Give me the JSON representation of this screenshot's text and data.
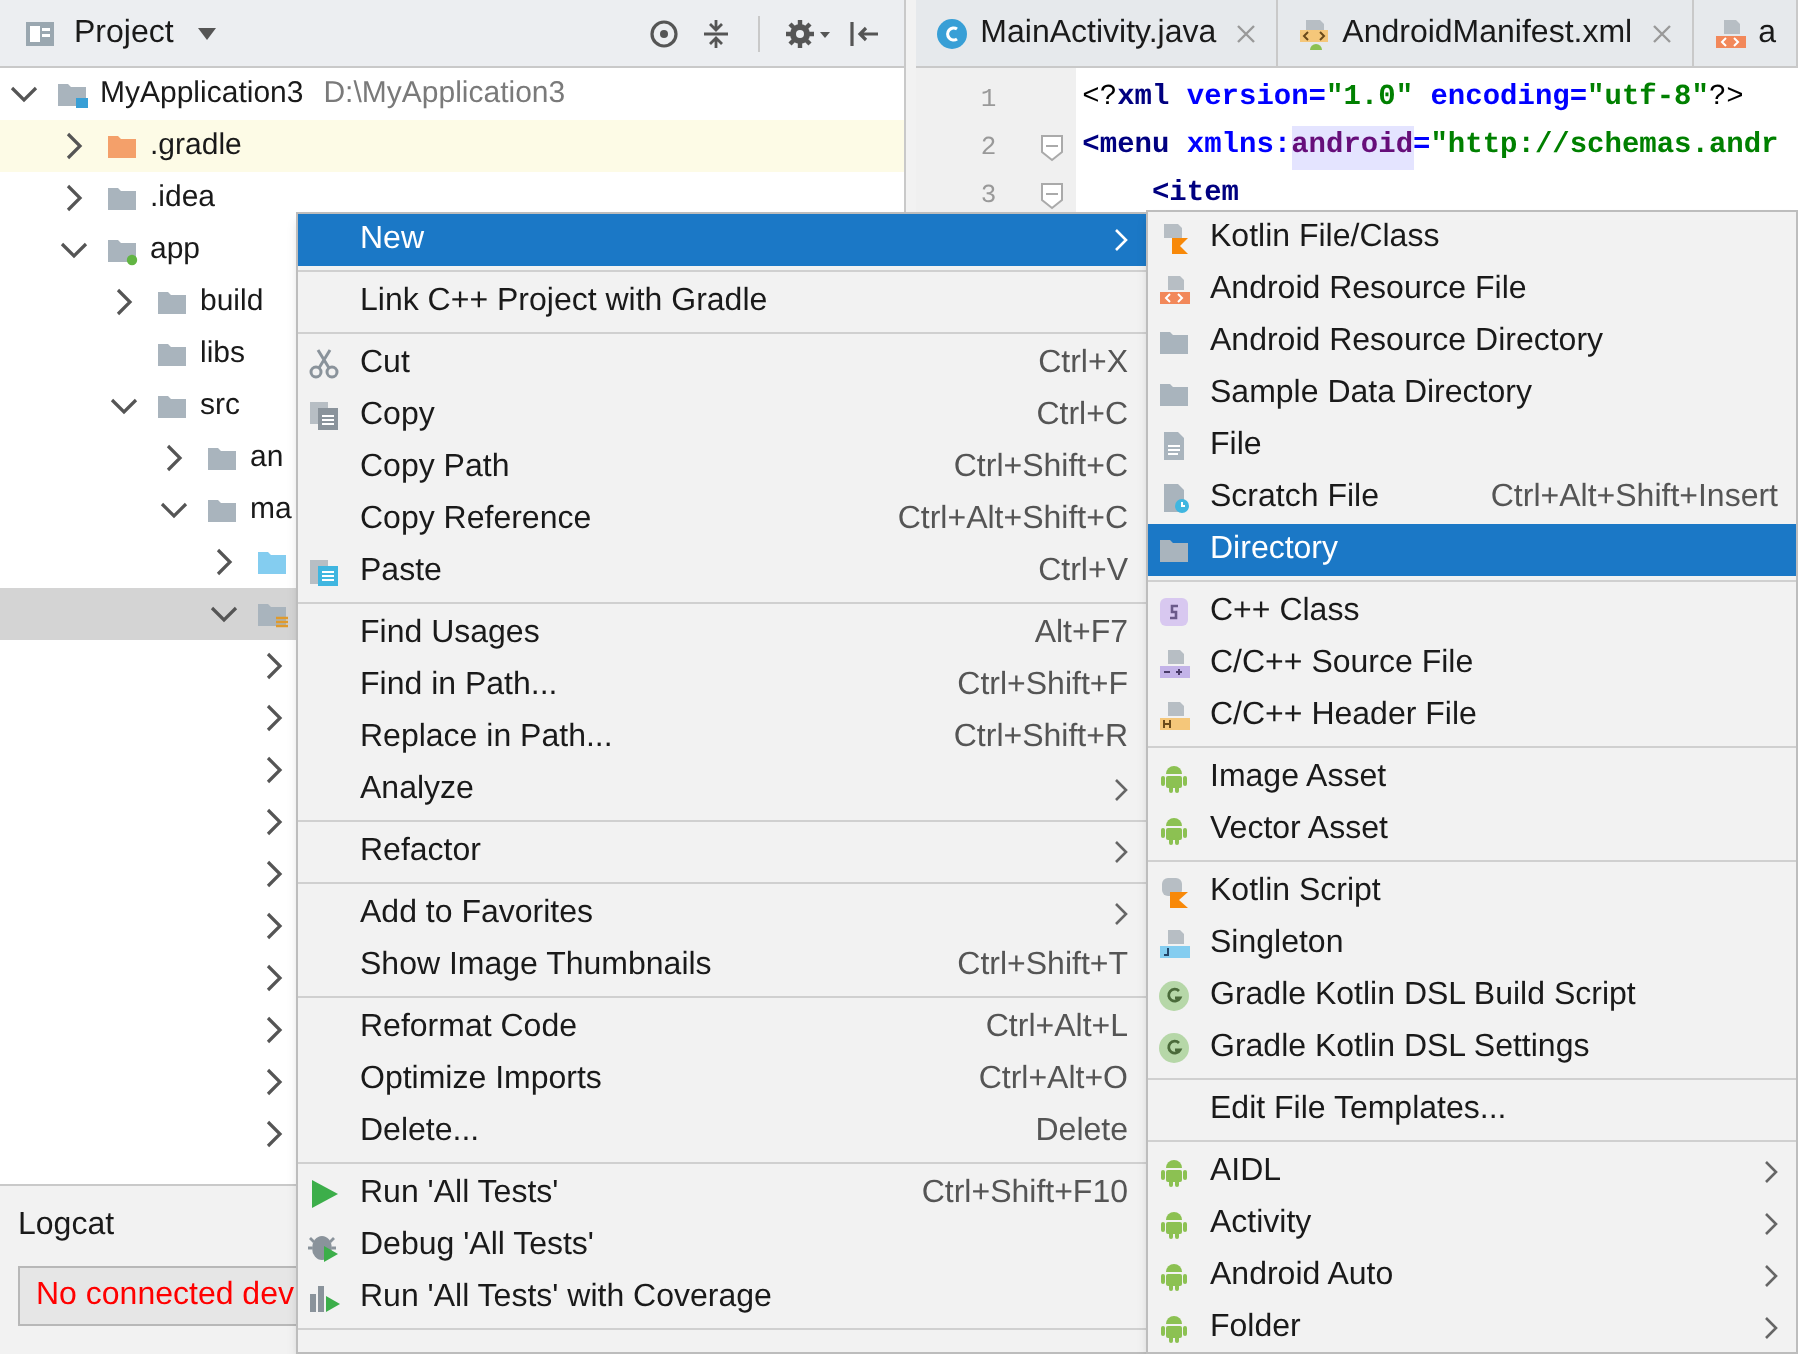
{
  "project_panel": {
    "title": "Project",
    "tree": [
      {
        "label": "MyApplication3",
        "hint": "D:\\MyApplication3",
        "kind": "module",
        "expanded": true,
        "selected": false,
        "children": [
          {
            "label": ".gradle",
            "kind": "excluded",
            "expanded": false,
            "selected": false
          },
          {
            "label": ".idea",
            "kind": "folder",
            "expanded": false,
            "selected": false
          },
          {
            "label": "app",
            "kind": "app",
            "expanded": true,
            "selected": false,
            "children": [
              {
                "label": "build",
                "kind": "folder",
                "expanded": false,
                "selected": false
              },
              {
                "label": "libs",
                "kind": "folder",
                "selected": false
              },
              {
                "label": "src",
                "kind": "folder",
                "expanded": true,
                "selected": false,
                "children": [
                  {
                    "label": "an",
                    "kind": "folder",
                    "expanded": false,
                    "selected": false
                  },
                  {
                    "label": "ma",
                    "kind": "folder",
                    "expanded": true,
                    "selected": false,
                    "children": [
                      {
                        "kind": "source",
                        "expanded": false,
                        "selected": false
                      },
                      {
                        "kind": "resources",
                        "expanded": true,
                        "selected": true,
                        "children": [
                          {
                            "expanded": false,
                            "selected": false
                          },
                          {
                            "expanded": false,
                            "selected": false
                          },
                          {
                            "expanded": false,
                            "selected": false
                          },
                          {
                            "expanded": false,
                            "selected": false
                          },
                          {
                            "expanded": false,
                            "selected": false
                          },
                          {
                            "expanded": false,
                            "selected": false
                          },
                          {
                            "expanded": false,
                            "selected": false
                          },
                          {
                            "expanded": false,
                            "selected": false
                          },
                          {
                            "expanded": false,
                            "selected": false
                          },
                          {
                            "expanded": false,
                            "selected": false
                          }
                        ]
                      }
                    ]
                  }
                ]
              }
            ]
          }
        ]
      }
    ]
  },
  "editor": {
    "tabs": [
      {
        "label": "MainActivity.java",
        "kind": "class",
        "closable": true
      },
      {
        "label": "AndroidManifest.xml",
        "kind": "manifest",
        "closable": true
      },
      {
        "label": "a",
        "kind": "resource",
        "closable": false
      }
    ],
    "lines": [
      {
        "number": "1",
        "fold": false,
        "tokens": [
          {
            "text": "<?",
            "kind": "plain"
          },
          {
            "text": "xml",
            "kind": "tag"
          },
          {
            "text": " version=",
            "kind": "attr"
          },
          {
            "text": "\"1.0\"",
            "kind": "value"
          },
          {
            "text": " encoding=",
            "kind": "attr"
          },
          {
            "text": "\"utf-8\"",
            "kind": "value"
          },
          {
            "text": "?>",
            "kind": "plain"
          }
        ]
      },
      {
        "number": "2",
        "fold": true,
        "tokens": [
          {
            "text": "<menu",
            "kind": "tag"
          },
          {
            "text": " xmlns:",
            "kind": "attr"
          },
          {
            "text": "android",
            "kind": "ns"
          },
          {
            "text": "=",
            "kind": "attr"
          },
          {
            "text": "\"http://schemas.andr",
            "kind": "value"
          }
        ]
      },
      {
        "number": "3",
        "fold": true,
        "tokens": [
          {
            "text": "    <item",
            "kind": "tag"
          }
        ]
      }
    ]
  },
  "logcat": {
    "title": "Logcat",
    "device": "No connected dev"
  },
  "context_menu": {
    "items": [
      {
        "kind": "plain",
        "label": "New",
        "submenu": true,
        "selected": true
      },
      {
        "kind": "separator"
      },
      {
        "kind": "plain",
        "label": "Link C++ Project with Gradle",
        "submenu": false,
        "selected": false
      },
      {
        "kind": "separator"
      },
      {
        "kind": "scissors",
        "label": "Cut",
        "shortcut": "Ctrl+X",
        "submenu": false,
        "selected": false
      },
      {
        "kind": "copy",
        "label": "Copy",
        "shortcut": "Ctrl+C",
        "submenu": false,
        "selected": false
      },
      {
        "kind": "plain",
        "label": "Copy Path",
        "shortcut": "Ctrl+Shift+C",
        "submenu": false,
        "selected": false
      },
      {
        "kind": "plain",
        "label": "Copy Reference",
        "shortcut": "Ctrl+Alt+Shift+C",
        "submenu": false,
        "selected": false
      },
      {
        "kind": "paste",
        "label": "Paste",
        "shortcut": "Ctrl+V",
        "submenu": false,
        "selected": false
      },
      {
        "kind": "separator"
      },
      {
        "kind": "plain",
        "label": "Find Usages",
        "shortcut": "Alt+F7",
        "submenu": false,
        "selected": false
      },
      {
        "kind": "plain",
        "label": "Find in Path...",
        "shortcut": "Ctrl+Shift+F",
        "submenu": false,
        "selected": false
      },
      {
        "kind": "plain",
        "label": "Replace in Path...",
        "shortcut": "Ctrl+Shift+R",
        "submenu": false,
        "selected": false
      },
      {
        "kind": "plain",
        "label": "Analyze",
        "submenu": true,
        "selected": false
      },
      {
        "kind": "separator"
      },
      {
        "kind": "plain",
        "label": "Refactor",
        "submenu": true,
        "selected": false
      },
      {
        "kind": "separator"
      },
      {
        "kind": "plain",
        "label": "Add to Favorites",
        "submenu": true,
        "selected": false
      },
      {
        "kind": "plain",
        "label": "Show Image Thumbnails",
        "shortcut": "Ctrl+Shift+T",
        "submenu": false,
        "selected": false
      },
      {
        "kind": "separator"
      },
      {
        "kind": "plain",
        "label": "Reformat Code",
        "shortcut": "Ctrl+Alt+L",
        "submenu": false,
        "selected": false
      },
      {
        "kind": "plain",
        "label": "Optimize Imports",
        "shortcut": "Ctrl+Alt+O",
        "submenu": false,
        "selected": false
      },
      {
        "kind": "plain",
        "label": "Delete...",
        "shortcut": "Delete",
        "submenu": false,
        "selected": false
      },
      {
        "kind": "separator"
      },
      {
        "kind": "run",
        "label": "Run 'All Tests'",
        "shortcut": "Ctrl+Shift+F10",
        "submenu": false,
        "selected": false
      },
      {
        "kind": "debug",
        "label": "Debug 'All Tests'",
        "submenu": false,
        "selected": false
      },
      {
        "kind": "coverage",
        "label": "Run 'All Tests' with Coverage",
        "submenu": false,
        "selected": false
      },
      {
        "kind": "separator"
      }
    ]
  },
  "submenu": {
    "items": [
      {
        "kind": "kotlin",
        "label": "Kotlin File/Class",
        "submenu": false,
        "selected": false
      },
      {
        "kind": "resource",
        "label": "Android Resource File",
        "submenu": false,
        "selected": false
      },
      {
        "kind": "folder",
        "label": "Android Resource Directory",
        "submenu": false,
        "selected": false
      },
      {
        "kind": "folder",
        "label": "Sample Data Directory",
        "submenu": false,
        "selected": false
      },
      {
        "kind": "file",
        "label": "File",
        "submenu": false,
        "selected": false
      },
      {
        "kind": "scratch",
        "label": "Scratch File",
        "shortcut": "Ctrl+Alt+Shift+Insert",
        "submenu": false,
        "selected": false
      },
      {
        "kind": "folder",
        "label": "Directory",
        "submenu": false,
        "selected": true
      },
      {
        "kind": "separator"
      },
      {
        "kind": "cppclass",
        "label": "C++ Class",
        "submenu": false,
        "selected": false
      },
      {
        "kind": "cppsource",
        "label": "C/C++ Source File",
        "submenu": false,
        "selected": false
      },
      {
        "kind": "cppheader",
        "label": "C/C++ Header File",
        "submenu": false,
        "selected": false
      },
      {
        "kind": "separator"
      },
      {
        "kind": "android",
        "label": "Image Asset",
        "submenu": false,
        "selected": false
      },
      {
        "kind": "android",
        "label": "Vector Asset",
        "submenu": false,
        "selected": false
      },
      {
        "kind": "separator"
      },
      {
        "kind": "kotlinscript",
        "label": "Kotlin Script",
        "submenu": false,
        "selected": false
      },
      {
        "kind": "java",
        "label": "Singleton",
        "submenu": false,
        "selected": false
      },
      {
        "kind": "gradle",
        "label": "Gradle Kotlin DSL Build Script",
        "submenu": false,
        "selected": false
      },
      {
        "kind": "gradle",
        "label": "Gradle Kotlin DSL Settings",
        "submenu": false,
        "selected": false
      },
      {
        "kind": "separator"
      },
      {
        "kind": "plain",
        "label": "Edit File Templates...",
        "submenu": false,
        "selected": false
      },
      {
        "kind": "separator"
      },
      {
        "kind": "android",
        "label": "AIDL",
        "submenu": true,
        "selected": false
      },
      {
        "kind": "android",
        "label": "Activity",
        "submenu": true,
        "selected": false
      },
      {
        "kind": "android",
        "label": "Android Auto",
        "submenu": true,
        "selected": false
      },
      {
        "kind": "android",
        "label": "Folder",
        "submenu": true,
        "selected": false
      }
    ]
  }
}
